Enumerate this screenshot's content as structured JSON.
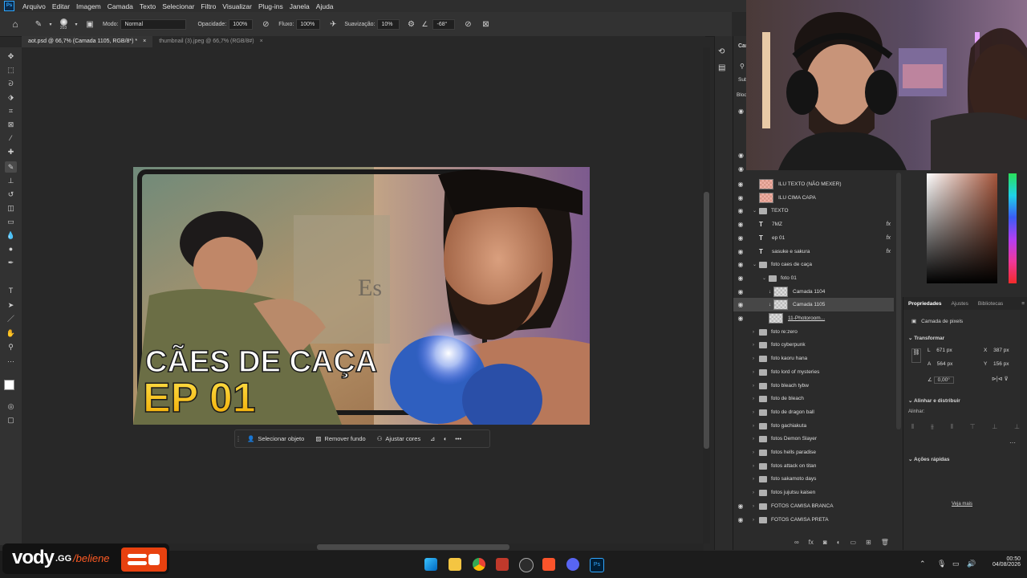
{
  "menu": {
    "items": [
      "Arquivo",
      "Editar",
      "Imagem",
      "Camada",
      "Texto",
      "Selecionar",
      "Filtro",
      "Visualizar",
      "Plug-ins",
      "Janela",
      "Ajuda"
    ]
  },
  "options": {
    "brush_size": "203",
    "mode_label": "Modo:",
    "mode_value": "Normal",
    "opacity_label": "Opacidade:",
    "opacity_value": "100%",
    "flow_label": "Fluxo:",
    "flow_value": "100%",
    "smoothing_label": "Suavização:",
    "smoothing_value": "10%",
    "angle_value": "-68°"
  },
  "tabs": [
    {
      "label": "aot.psd @ 66,7% (Camada 1105, RGB/8*) *",
      "close": "×"
    },
    {
      "label": "thumbnail (3).jpeg @ 66,7% (RGB/8#)",
      "close": "×"
    }
  ],
  "thumbnail": {
    "title_line1": "CÃES DE CAÇA",
    "title_line2": "EP 01",
    "sign_text": "Es"
  },
  "context_bar": {
    "select_object": "Selecionar objeto",
    "remove_bg": "Remover fundo",
    "adjust_colors": "Ajustar cores",
    "more": "•••"
  },
  "layers_panel": {
    "header_fragments": {
      "title": "Cam",
      "kind": "Sub",
      "lock": "Bloq"
    },
    "rows": [
      {
        "name": "ILU TEXTO (NÃO MEXER)",
        "type": "pixel",
        "visible": true
      },
      {
        "name": "ILU CIMA CAPA",
        "type": "pixel",
        "visible": true
      },
      {
        "name": "TEXTO",
        "type": "group-open",
        "visible": true
      },
      {
        "name": "7MZ",
        "type": "text",
        "visible": true,
        "fx": "fx"
      },
      {
        "name": "ep 01",
        "type": "text",
        "visible": true,
        "fx": "fx"
      },
      {
        "name": "sasuke e sakura",
        "type": "text",
        "visible": true,
        "fx": "fx"
      },
      {
        "name": "foto caes de caça",
        "type": "group-open",
        "visible": true
      },
      {
        "name": "foto 01",
        "type": "group-open-sub",
        "visible": true
      },
      {
        "name": "Camada 1104",
        "type": "clip-pixel",
        "visible": true
      },
      {
        "name": "Camada 1105",
        "type": "clip-pixel",
        "visible": true,
        "selected": true
      },
      {
        "name": "11-Photoroom...",
        "type": "smart",
        "visible": true
      },
      {
        "name": "foto re:zero",
        "type": "group",
        "visible": false
      },
      {
        "name": "foto cyberpunk",
        "type": "group",
        "visible": false
      },
      {
        "name": "foto kaoru hana",
        "type": "group",
        "visible": false
      },
      {
        "name": "foto lord of mysteries",
        "type": "group",
        "visible": false
      },
      {
        "name": "foto bleach tybw",
        "type": "group",
        "visible": false
      },
      {
        "name": "foto de bleach",
        "type": "group",
        "visible": false
      },
      {
        "name": "foto de dragon ball",
        "type": "group",
        "visible": false
      },
      {
        "name": "foto gachiakuta",
        "type": "group",
        "visible": false
      },
      {
        "name": "fotos Demon Slayer",
        "type": "group",
        "visible": false
      },
      {
        "name": "fotos hells paradise",
        "type": "group",
        "visible": false
      },
      {
        "name": "fotos  attack on titan",
        "type": "group",
        "visible": false
      },
      {
        "name": "foto sakamoto days",
        "type": "group",
        "visible": false
      },
      {
        "name": "fotos jujutsu kaisen",
        "type": "group",
        "visible": false
      },
      {
        "name": "FOTOS CAMISA BRANCA",
        "type": "group",
        "visible": true
      },
      {
        "name": "FOTOS CAMISA PRETA",
        "type": "group",
        "visible": true
      }
    ]
  },
  "properties": {
    "tabs": [
      "Propriedades",
      "Ajustes",
      "Bibliotecas"
    ],
    "kind": "Camada de pixels",
    "transform_label": "Transformar",
    "L_label": "L",
    "L_value": "671 px",
    "X_label": "X",
    "X_value": "387 px",
    "A_label": "A",
    "A_value": "564 px",
    "Y_label": "Y",
    "Y_value": "156 px",
    "angle_value": "0,00°",
    "align_label": "Alinhar e distribuir",
    "align_sub": "Alinhar:",
    "quick_label": "Ações rápidas",
    "more_link": "Veja mais"
  },
  "overlay": {
    "brand": "vody",
    "brand_suffix": ".GG",
    "slash": "/beliene"
  },
  "taskbar": {
    "time": "00:50",
    "date": "04/08/2026"
  },
  "colors": {
    "accent_blue": "#31a8ff",
    "panel_bg": "#2b2b2b",
    "selected_row": "#474747",
    "title_yellow": "#f5c518"
  }
}
